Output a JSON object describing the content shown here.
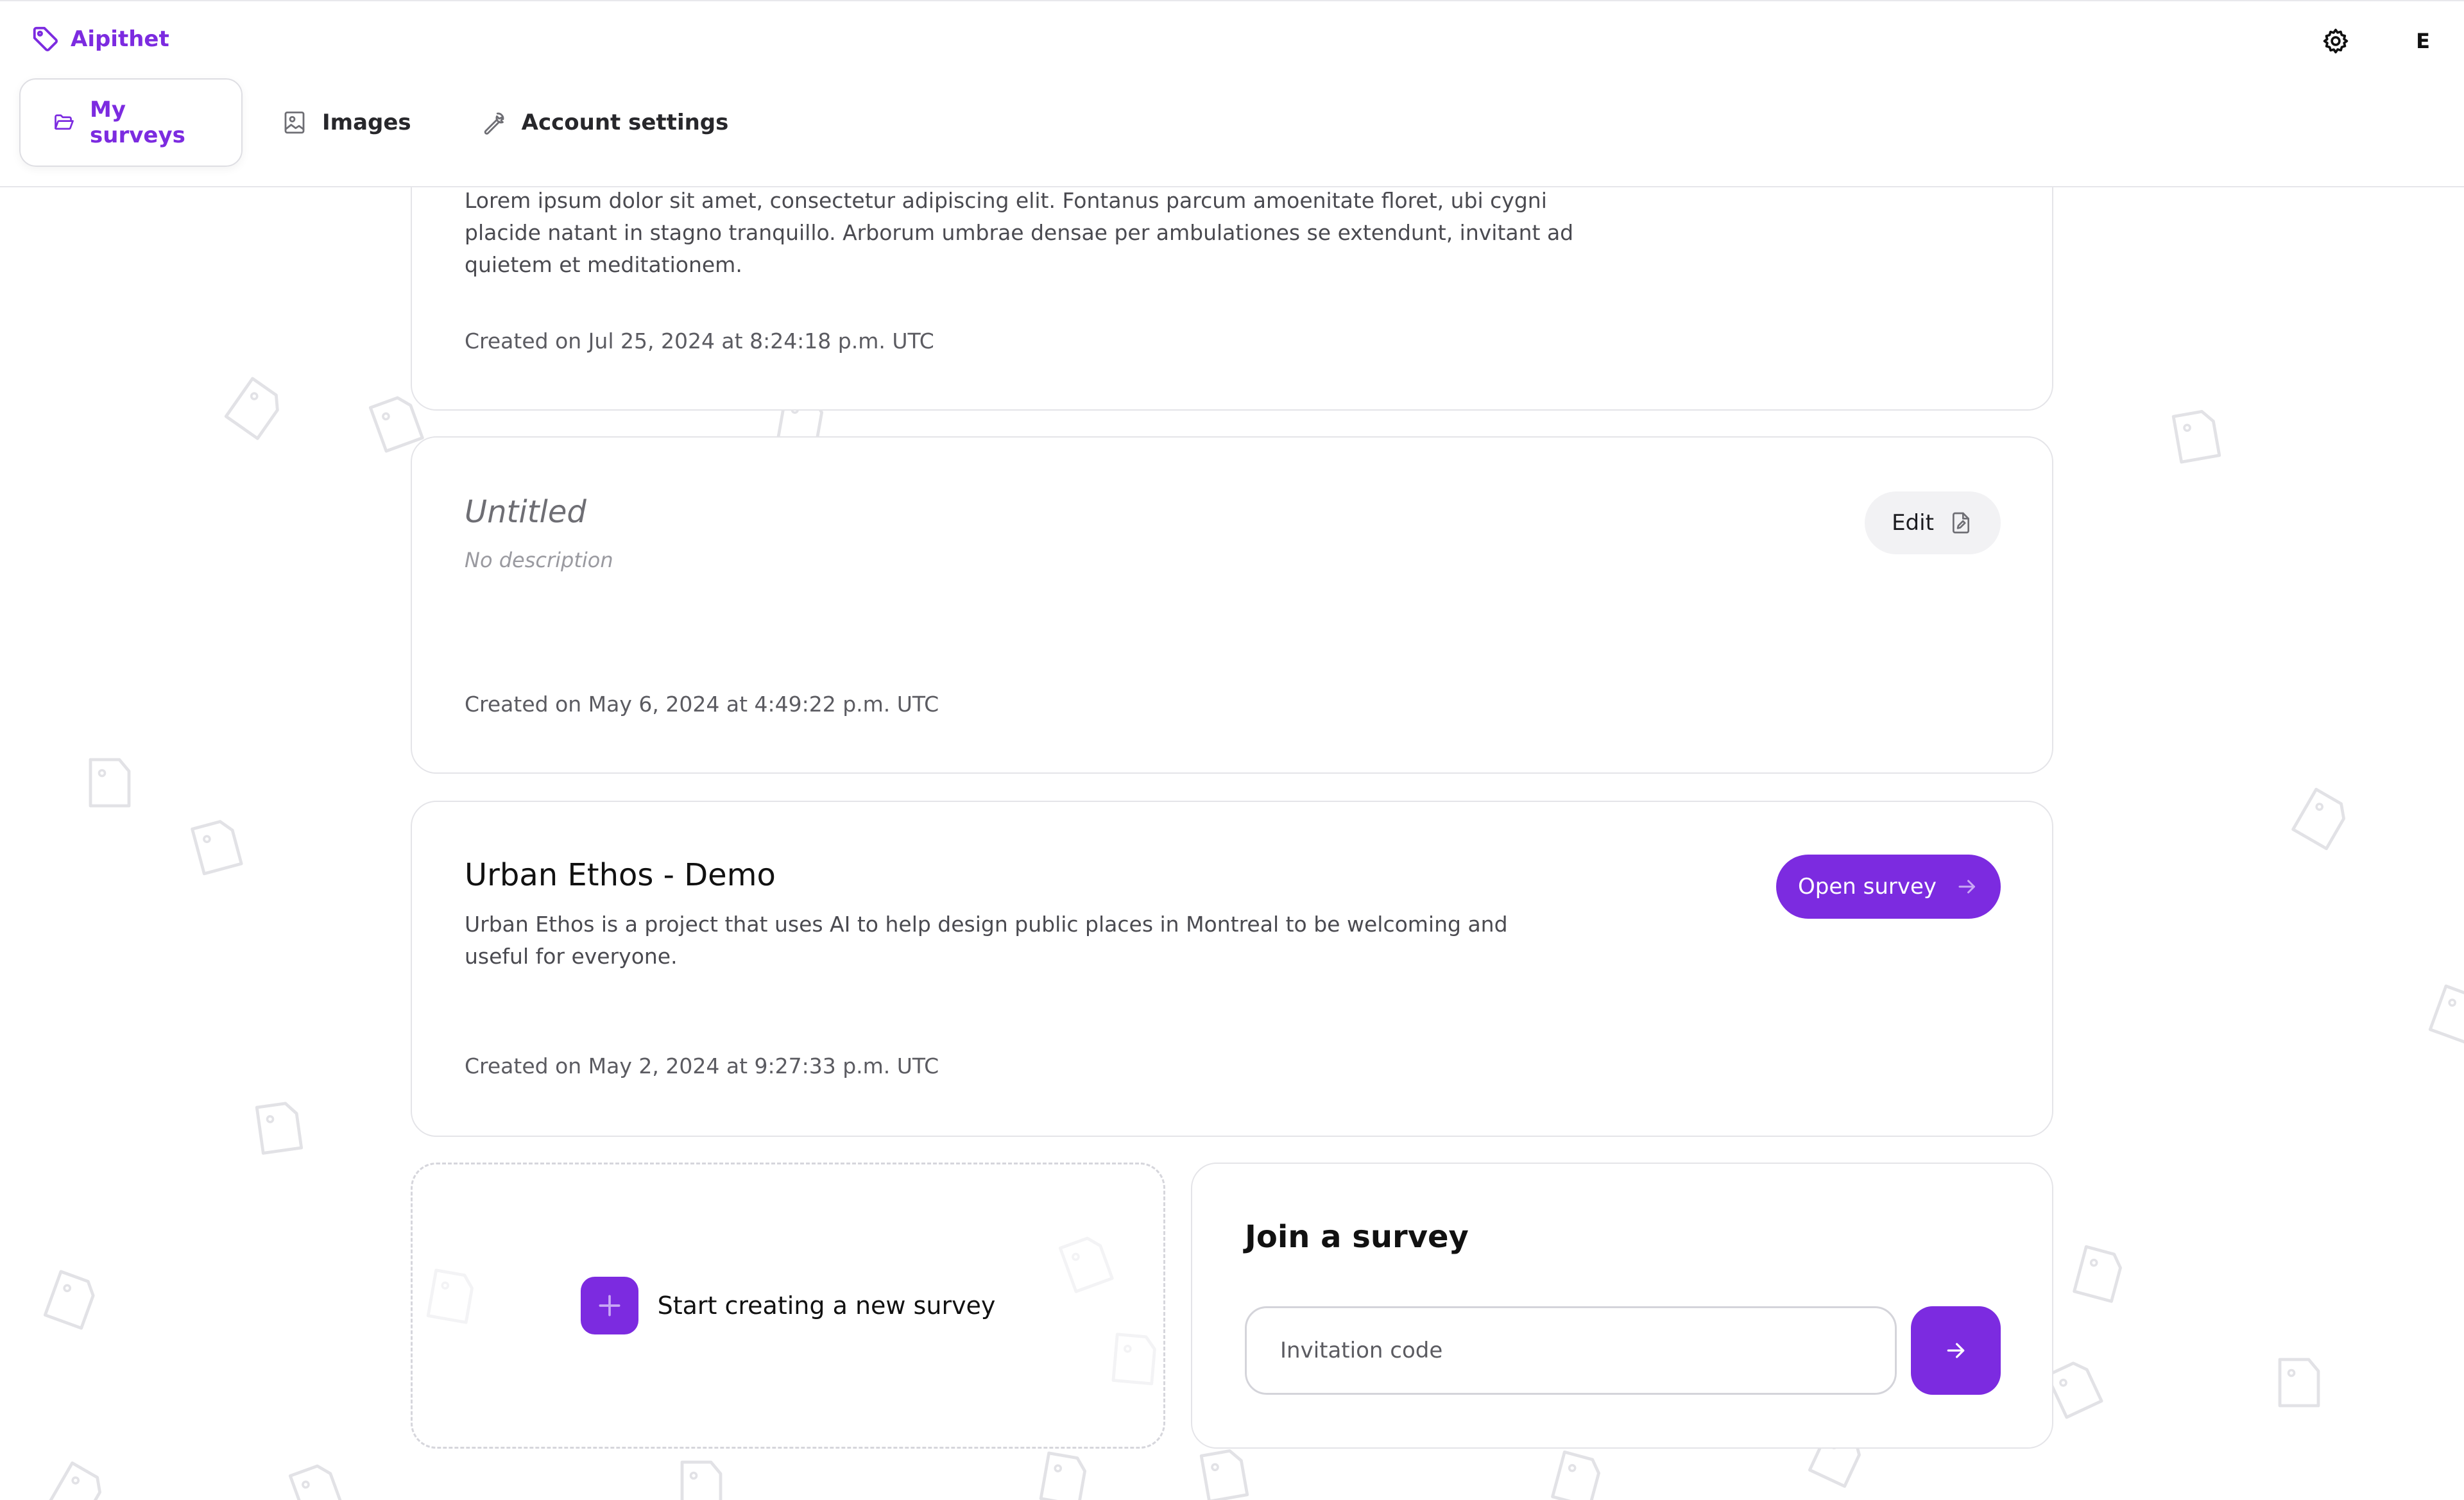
{
  "app": {
    "name": "Aipithet",
    "accent_color": "#7c2be0"
  },
  "header": {
    "settings_icon": "gear-icon",
    "avatar_initial": "E",
    "tabs": [
      {
        "label": "My surveys",
        "icon": "folder-open-icon",
        "active": true
      },
      {
        "label": "Images",
        "icon": "image-icon",
        "active": false
      },
      {
        "label": "Account settings",
        "icon": "wrench-icon",
        "active": false
      }
    ]
  },
  "surveys": [
    {
      "title": "",
      "description": "Lorem ipsum dolor sit amet, consectetur adipiscing elit. Fontanus parcum amoenitate floret, ubi cygni placide natant in stagno tranquillo. Arborum umbrae densae per ambulationes se extendunt, invitant ad quietem et meditationem.",
      "created": "Created on Jul 25, 2024 at 8:24:18 p.m. UTC"
    },
    {
      "title": "Untitled",
      "description": "No description",
      "created": "Created on May 6, 2024 at 4:49:22 p.m. UTC",
      "action_label": "Edit",
      "action_icon": "edit-file-icon"
    },
    {
      "title": "Urban Ethos - Demo",
      "description": "Urban Ethos is a project that uses AI to help design public places in Montreal to be welcoming and useful for everyone.",
      "created": "Created on May 2, 2024 at 9:27:33 p.m. UTC",
      "action_label": "Open survey",
      "action_icon": "arrow-right-icon"
    }
  ],
  "create": {
    "label": "Start creating a new survey",
    "icon": "plus-icon"
  },
  "join": {
    "title": "Join a survey",
    "input_placeholder": "Invitation code",
    "input_value": "",
    "submit_icon": "arrow-right-icon"
  }
}
